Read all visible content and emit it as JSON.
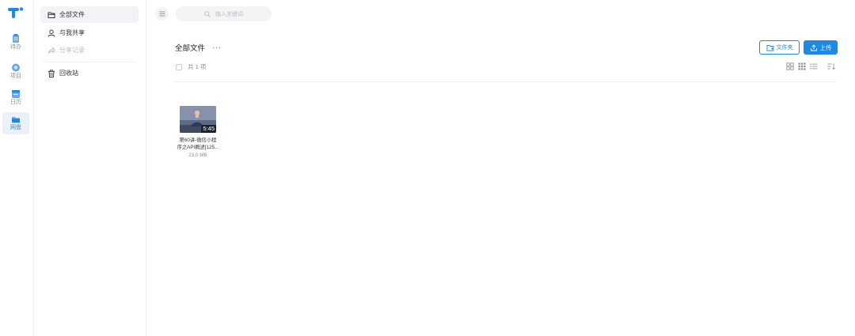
{
  "rail": {
    "items": [
      {
        "label": "待办"
      },
      {
        "label": "项目"
      },
      {
        "label": "日历"
      },
      {
        "label": "网盘"
      }
    ],
    "accent": "#1e88e5"
  },
  "sidebar": {
    "items": [
      {
        "label": "全部文件"
      },
      {
        "label": "与我共享"
      },
      {
        "label": "分享记录"
      },
      {
        "label": "回收站"
      }
    ]
  },
  "search": {
    "placeholder": "输入关键词"
  },
  "main": {
    "title": "全部文件",
    "more": "···",
    "new_folder_label": "文件夹",
    "upload_label": "上传",
    "count_label": "共 1 项"
  },
  "files": [
    {
      "name_line1": "第60讲-微信小程",
      "name_line2": "序之API概述[125...",
      "size": "23.0 MB",
      "duration": "5:45"
    }
  ]
}
